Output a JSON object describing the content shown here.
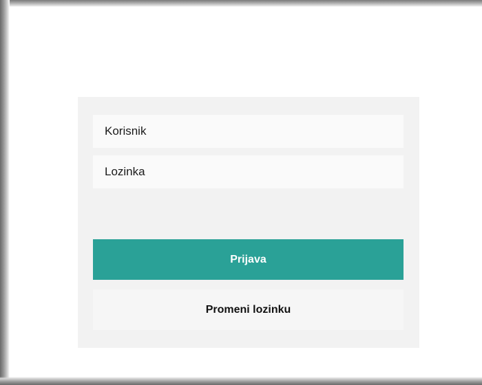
{
  "login": {
    "username_placeholder": "Korisnik",
    "password_placeholder": "Lozinka",
    "login_label": "Prijava",
    "change_password_label": "Promeni lozinku"
  },
  "colors": {
    "accent": "#2aa197",
    "panel_bg": "#f2f2f2",
    "field_bg": "#fafafa"
  }
}
